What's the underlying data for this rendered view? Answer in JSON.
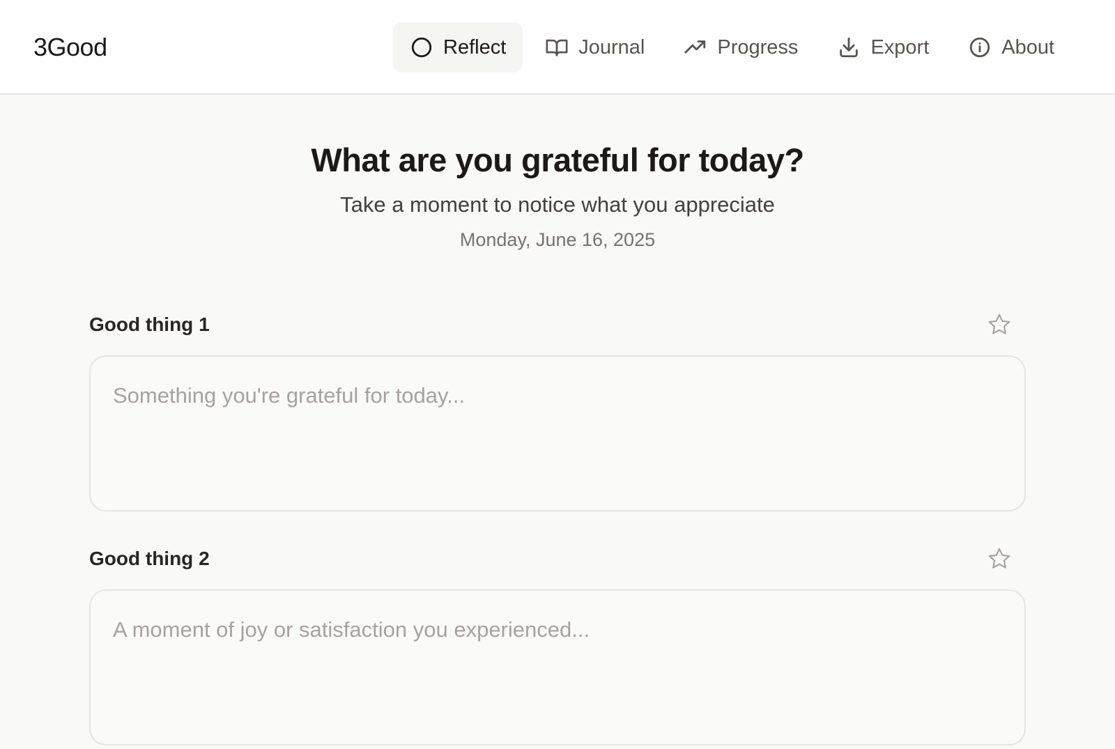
{
  "app": {
    "title": "3Good"
  },
  "nav": {
    "items": [
      {
        "label": "Reflect",
        "icon": "circle-icon",
        "active": true
      },
      {
        "label": "Journal",
        "icon": "book-open-icon",
        "active": false
      },
      {
        "label": "Progress",
        "icon": "trending-up-icon",
        "active": false
      },
      {
        "label": "Export",
        "icon": "download-icon",
        "active": false
      },
      {
        "label": "About",
        "icon": "info-icon",
        "active": false
      }
    ]
  },
  "hero": {
    "title": "What are you grateful for today?",
    "subtitle": "Take a moment to notice what you appreciate",
    "date": "Monday, June 16, 2025"
  },
  "entries": [
    {
      "label": "Good thing 1",
      "value": "",
      "placeholder": "Something you're grateful for today...",
      "starred": false
    },
    {
      "label": "Good thing 2",
      "value": "",
      "placeholder": "A moment of joy or satisfaction you experienced...",
      "starred": false
    }
  ],
  "colors": {
    "background": "#f9f9f8",
    "header_bg": "#ffffff",
    "active_nav_bg": "#f5f5f4",
    "text_primary": "#1c1917",
    "text_muted": "#78716c",
    "placeholder": "#a8a29e",
    "border": "#e7e5e4"
  }
}
